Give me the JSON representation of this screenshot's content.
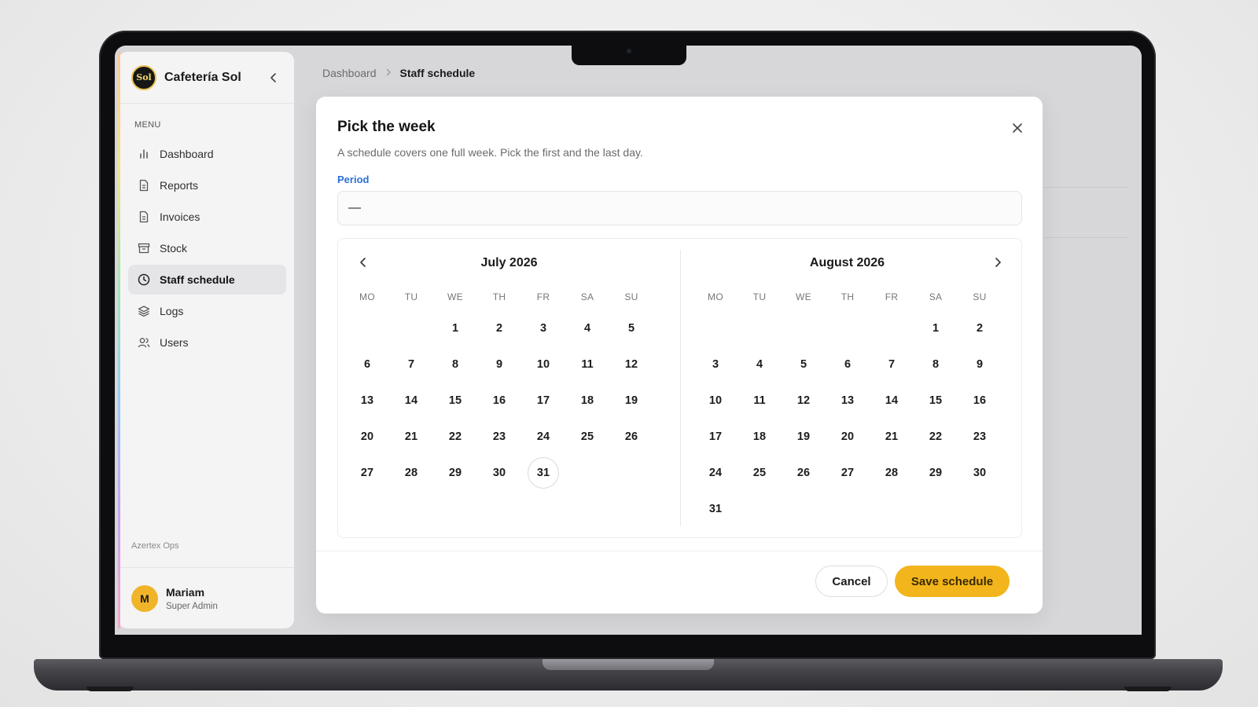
{
  "app": {
    "name": "Cafetería Sol",
    "logo_text": "Sol",
    "collapse_icon": "chevron-left-icon"
  },
  "sidebar": {
    "menu_label": "MENU",
    "items": [
      {
        "label": "Dashboard",
        "icon": "bar-chart-icon",
        "active": false
      },
      {
        "label": "Reports",
        "icon": "document-icon",
        "active": false
      },
      {
        "label": "Invoices",
        "icon": "document-icon",
        "active": false
      },
      {
        "label": "Stock",
        "icon": "archive-box-icon",
        "active": false
      },
      {
        "label": "Staff schedule",
        "icon": "clock-icon",
        "active": true
      },
      {
        "label": "Logs",
        "icon": "layers-icon",
        "active": false
      },
      {
        "label": "Users",
        "icon": "users-icon",
        "active": false
      }
    ],
    "footer_label": "Azertex Ops",
    "user": {
      "initial": "M",
      "name": "Mariam",
      "role": "Super Admin"
    }
  },
  "breadcrumb": {
    "parent": "Dashboard",
    "current": "Staff schedule"
  },
  "modal": {
    "title": "Pick the week",
    "description": "A schedule covers one full week. Pick the first and the last day.",
    "field_label": "Period",
    "period_value": "—",
    "weekdays": [
      "MO",
      "TU",
      "WE",
      "TH",
      "FR",
      "SA",
      "SU"
    ],
    "calendars": [
      {
        "title": "July 2026",
        "weeks": [
          [
            "",
            "",
            "1",
            "2",
            "3",
            "4",
            "5"
          ],
          [
            "6",
            "7",
            "8",
            "9",
            "10",
            "11",
            "12"
          ],
          [
            "13",
            "14",
            "15",
            "16",
            "17",
            "18",
            "19"
          ],
          [
            "20",
            "21",
            "22",
            "23",
            "24",
            "25",
            "26"
          ],
          [
            "27",
            "28",
            "29",
            "30",
            "31",
            "",
            ""
          ]
        ],
        "highlighted_day": "31"
      },
      {
        "title": "August 2026",
        "weeks": [
          [
            "",
            "",
            "",
            "",
            "",
            "1",
            "2"
          ],
          [
            "3",
            "4",
            "5",
            "6",
            "7",
            "8",
            "9"
          ],
          [
            "10",
            "11",
            "12",
            "13",
            "14",
            "15",
            "16"
          ],
          [
            "17",
            "18",
            "19",
            "20",
            "21",
            "22",
            "23"
          ],
          [
            "24",
            "25",
            "26",
            "27",
            "28",
            "29",
            "30"
          ],
          [
            "31",
            "",
            "",
            "",
            "",
            "",
            ""
          ]
        ],
        "highlighted_day": ""
      }
    ],
    "cancel_label": "Cancel",
    "save_label": "Save schedule"
  },
  "colors": {
    "accent": "#f2b51c",
    "link_blue": "#2a6fd6",
    "avatar": "#f0b429"
  }
}
